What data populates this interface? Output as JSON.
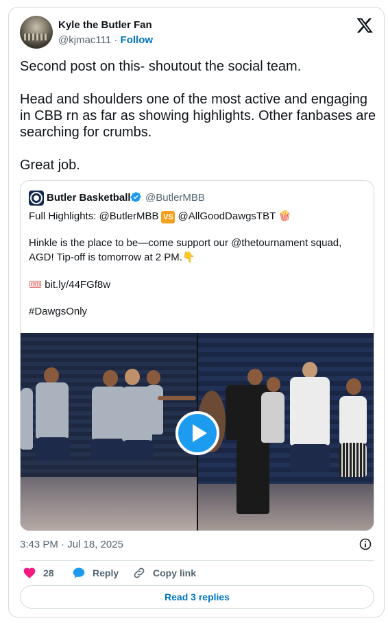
{
  "author": {
    "display_name": "Kyle the Butler Fan",
    "handle": "@kjmac111",
    "separator": "·",
    "follow_label": "Follow"
  },
  "post": {
    "paragraphs": [
      "Second post on this- shoutout the social team.",
      "Head and shoulders one of the most active and engaging in CBB rn as far as showing highlights. Other fanbases are searching for crumbs.",
      "Great job."
    ],
    "timestamp": "3:43 PM · Jul 18, 2025"
  },
  "quoted": {
    "name": "Butler Basketball",
    "handle": "@ButlerMBB",
    "line1_prefix": "Full Highlights: @ButlerMBB",
    "vs_badge": "VS",
    "line1_suffix": "@AllGoodDawgsTBT",
    "emoji_popcorn": "🍿",
    "line2": "Hinkle is the place to be—come support our @thetournament squad,",
    "line3": "AGD! Tip-off is tomorrow at 2 PM.",
    "emoji_point": "👇",
    "emoji_ticket": "🎟",
    "link": "bit.ly/44FGf8w",
    "hashtag": "#DawgsOnly"
  },
  "actions": {
    "like_count": "28",
    "reply_label": "Reply",
    "copy_label": "Copy link",
    "read_replies_label": "Read 3 replies"
  },
  "colors": {
    "like": "#f91880",
    "reply": "#1d9bf0",
    "link": "#0074c2",
    "play": "#1d9bf0",
    "verified": "#1d9bf0"
  }
}
